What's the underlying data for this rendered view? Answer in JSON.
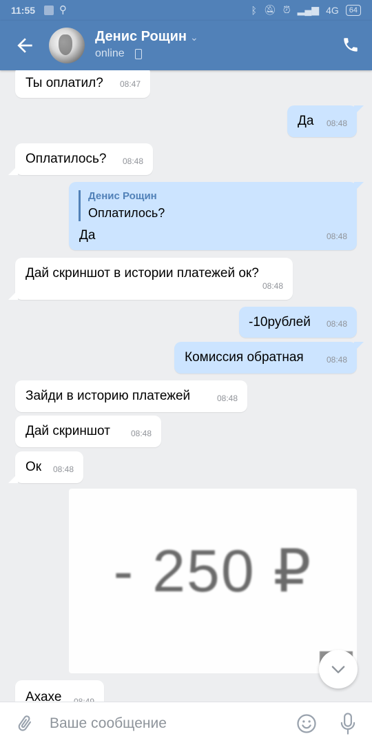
{
  "status_bar": {
    "time": "11:55",
    "network": "4G",
    "battery": "64"
  },
  "header": {
    "name": "Денис Рощин",
    "status": "online"
  },
  "messages": [
    {
      "text": "Ты оплатил?",
      "time": "08:47"
    },
    {
      "text": "Да",
      "time": "08:48"
    },
    {
      "text": "Оплатилось?",
      "time": "08:48"
    },
    {
      "quote_author": "Денис Рощин",
      "quote_text": "Оплатилось?",
      "text": "Да",
      "time": "08:48"
    },
    {
      "text": "Дай скриншот в истории платежей ок?",
      "time": "08:48"
    },
    {
      "text": "-10рублей",
      "time": "08:48"
    },
    {
      "text": "Комиссия обратная",
      "time": "08:48"
    },
    {
      "text": "Зайди в историю платежей",
      "time": "08:48"
    },
    {
      "text": "Дай скриншот",
      "time": "08:48"
    },
    {
      "text": "Ок",
      "time": "08:48"
    },
    {
      "text": "Ахахе",
      "time": "08:49"
    }
  ],
  "photo": {
    "amount_text": "- 250 ₽"
  },
  "input": {
    "placeholder": "Ваше сообщение"
  },
  "colors": {
    "header": "#5181b8",
    "outgoing": "#cce4ff",
    "incoming": "#ffffff",
    "background": "#edeef0"
  }
}
